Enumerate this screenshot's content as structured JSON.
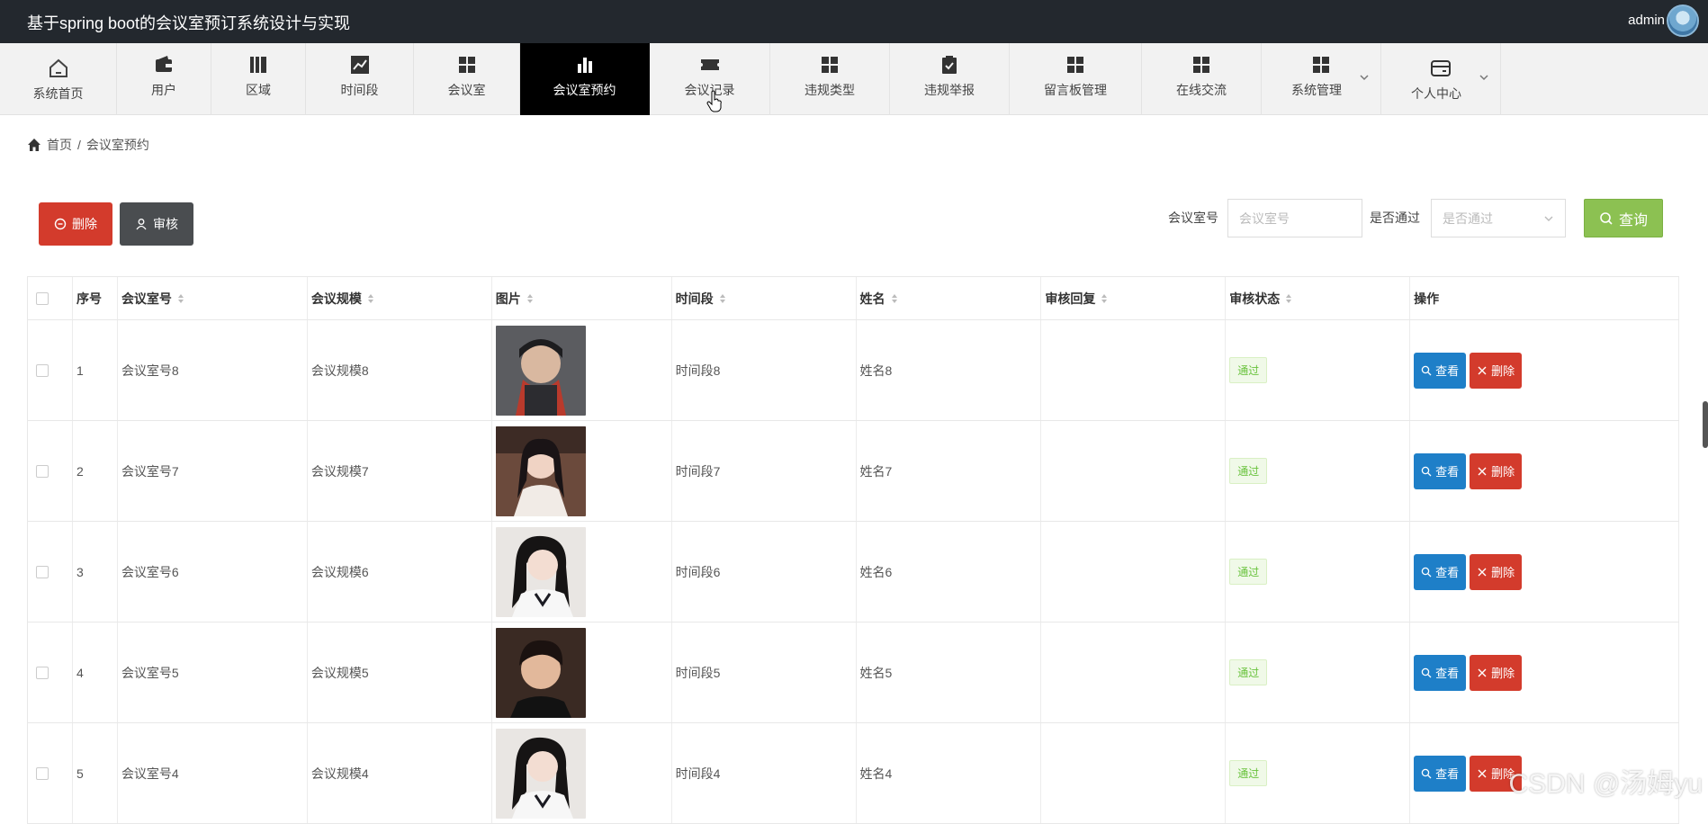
{
  "app": {
    "title": "基于spring boot的会议室预订系统设计与实现",
    "user": "admin"
  },
  "nav": [
    {
      "label": "系统首页",
      "icon": "home-icon"
    },
    {
      "label": "用户",
      "icon": "wallet-icon"
    },
    {
      "label": "区域",
      "icon": "books-icon"
    },
    {
      "label": "时间段",
      "icon": "line-chart-icon"
    },
    {
      "label": "会议室",
      "icon": "grid-icon"
    },
    {
      "label": "会议室预约",
      "icon": "bar-chart-icon",
      "active": true
    },
    {
      "label": "会议记录",
      "icon": "ticket-icon"
    },
    {
      "label": "违规类型",
      "icon": "grid-icon"
    },
    {
      "label": "违规举报",
      "icon": "clipboard-check-icon"
    },
    {
      "label": "留言板管理",
      "icon": "grid-icon"
    },
    {
      "label": "在线交流",
      "icon": "grid-icon"
    },
    {
      "label": "系统管理",
      "icon": "grid-icon",
      "dropdown": true
    },
    {
      "label": "个人中心",
      "icon": "card-icon",
      "dropdown": true
    }
  ],
  "breadcrumb": {
    "home": "首页",
    "separator": "/",
    "current": "会议室预约"
  },
  "toolbar": {
    "delete_label": "删除",
    "audit_label": "审核"
  },
  "filters": {
    "room_label": "会议室号",
    "room_placeholder": "会议室号",
    "pass_label": "是否通过",
    "pass_placeholder": "是否通过",
    "query_label": "查询"
  },
  "table": {
    "columns": [
      "序号",
      "会议室号",
      "会议规模",
      "图片",
      "时间段",
      "姓名",
      "审核回复",
      "审核状态",
      "操作"
    ],
    "rows": [
      {
        "index": "1",
        "room": "会议室号8",
        "scale": "会议规模8",
        "time": "时间段8",
        "name": "姓名8",
        "reply": "",
        "status": "通过"
      },
      {
        "index": "2",
        "room": "会议室号7",
        "scale": "会议规模7",
        "time": "时间段7",
        "name": "姓名7",
        "reply": "",
        "status": "通过"
      },
      {
        "index": "3",
        "room": "会议室号6",
        "scale": "会议规模6",
        "time": "时间段6",
        "name": "姓名6",
        "reply": "",
        "status": "通过"
      },
      {
        "index": "4",
        "room": "会议室号5",
        "scale": "会议规模5",
        "time": "时间段5",
        "name": "姓名5",
        "reply": "",
        "status": "通过"
      },
      {
        "index": "5",
        "room": "会议室号4",
        "scale": "会议规模4",
        "time": "时间段4",
        "name": "姓名4",
        "reply": "",
        "status": "通过"
      }
    ],
    "view_label": "查看",
    "delete_label": "删除"
  },
  "watermark": "CSDN @汤姆yu"
}
